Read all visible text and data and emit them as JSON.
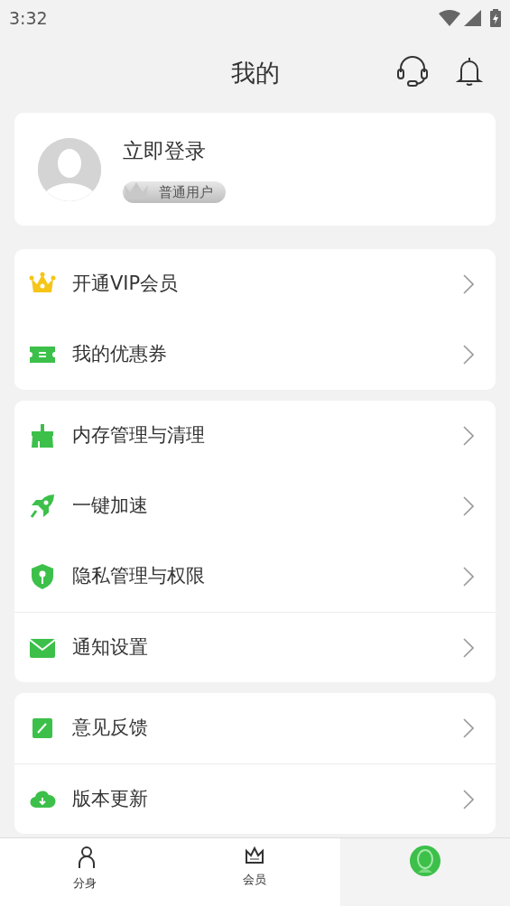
{
  "status_bar": {
    "time": "3:32"
  },
  "header": {
    "title": "我的"
  },
  "profile": {
    "login": "立即登录",
    "badge": "普通用户"
  },
  "groups": [
    {
      "items": [
        {
          "label": "开通VIP会员",
          "separated": false
        },
        {
          "label": "我的优惠券",
          "separated": false
        }
      ]
    },
    {
      "items": [
        {
          "label": "内存管理与清理",
          "separated": false
        },
        {
          "label": "一键加速",
          "separated": false
        },
        {
          "label": "隐私管理与权限",
          "separated": false
        },
        {
          "label": "通知设置",
          "separated": true
        }
      ]
    },
    {
      "items": [
        {
          "label": "意见反馈",
          "separated": false
        },
        {
          "label": "版本更新",
          "separated": true
        }
      ]
    }
  ],
  "bottom_nav": [
    {
      "label": "分身",
      "selected": false
    },
    {
      "label": "会员",
      "selected": false
    },
    {
      "selected": true
    }
  ]
}
